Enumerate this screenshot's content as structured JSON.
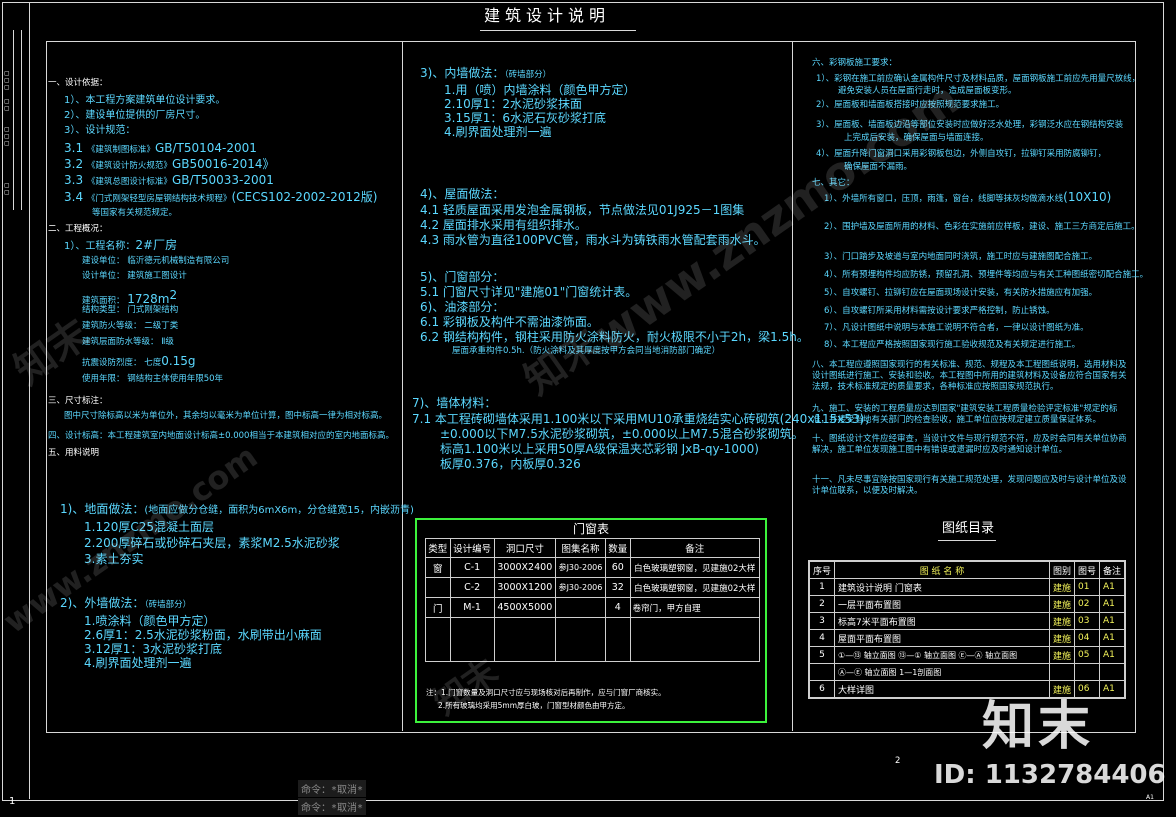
{
  "title": "建筑设计说明",
  "col1": {
    "s1_head": "一、设计依据：",
    "s1_items": [
      "1）、本工程方案建筑单位设计要求。",
      "2）、建设单位提供的厂房尺寸。",
      "3）、设计规范："
    ],
    "norms": [
      {
        "n": "3.1",
        "lbl": "《建筑制图标准》",
        "code": "GB/T50104-2001"
      },
      {
        "n": "3.2",
        "lbl": "《建筑设计防火规范》",
        "code": "GB50016-2014》"
      },
      {
        "n": "3.3",
        "lbl": "《建筑总图设计标准》",
        "code": "GB/T50033-2001"
      },
      {
        "n": "3.4",
        "lbl": "《门式刚架轻型房屋钢结构技术规程》",
        "code": "(CECS102-2002-2012版)"
      }
    ],
    "norms_tail": "等国家有关规范规定。",
    "s2_head": "二、工程概况：",
    "proj_lbl": "1）、工程名称：",
    "proj_val": "2#厂房",
    "info": [
      "建设单位：   临沂德元机械制造有限公司",
      "设计单位：   建筑施工图设计",
      "建筑面积：",
      "结构类型：   门式刚架结构",
      "建筑防火等级：  二级丁类",
      "建筑层面防水等级：  Ⅱ级",
      "抗震设防烈度：  七度"
    ],
    "area_val": "1728m",
    "area_sup": "2",
    "seis_val": "0.15g",
    "life": "使用年限：   钢结构主体使用年限50年",
    "s3_head": "三、尺寸标注：",
    "s3_body": "图中尺寸除标高以米为单位外，其余均以毫米为单位计算，图中标高一律为相对标高。",
    "s4": "四、设计标高：本工程建筑室内地面设计标高±0.000相当于本建筑相对应的室内地面标高。",
    "s5": "五、用料说明",
    "floor_head": "1)、地面做法：",
    "floor_note": "(地面应做分仓缝，面积为6mX6m，分仓缝宽15，内嵌沥青)",
    "floor_items": [
      "1.120厚C25混凝土面层",
      "2.200厚碎石或砂碎石夹层，素浆M2.5水泥砂浆",
      "3.素土夯实"
    ],
    "wall_head": "2)、外墙做法：",
    "wall_note": "（砖墙部分）",
    "wall_items": [
      "1.喷涂料（颜色甲方定）",
      "2.6厚1：2.5水泥砂浆粉面，水刷带出小麻面",
      "3.12厚1：3水泥砂浆打底",
      "4.刷界面处理剂一遍"
    ]
  },
  "col2": {
    "in_head": "3)、内墙做法：",
    "in_note": "（砖墙部分）",
    "in_items": [
      "1.用（喷）内墙涂料（颜色甲方定）",
      "2.10厚1：2水泥砂浆抹面",
      "3.15厚1：6水泥石灰砂浆打底",
      "4.刷界面处理剂一遍"
    ],
    "roof_head": "4)、屋面做法：",
    "roof_items": [
      "4.1  轻质屋面采用发泡金属钢板，节点做法见01J925－1图集",
      "4.2  屋面排水采用有组织排水。",
      "4.3  雨水管为直径100PVC管，雨水斗为铸铁雨水管配套雨水斗。"
    ],
    "door_head": "5)、门窗部分：",
    "door_items": [
      "5.1  门窗尺寸详见\"建施01\"门窗统计表。"
    ],
    "paint_head": "6)、油漆部分：",
    "paint_items": [
      "6.1  彩钢板及构件不需油漆饰面。",
      "6.2  钢结构构件，钢柱采用防火涂料防火，耐火极限不小于2h，梁1.5h。",
      "屋面承重构件0.5h.（防火涂料及其厚度按甲方会同当地消防部门确定）"
    ],
    "wall_head": "7)、墙体材料：",
    "wall_items": [
      "7.1  本工程砖砌墙体采用1.100米以下采用MU10承重烧结实心砖砌筑(240x115x53)，",
      "±0.000以下M7.5水泥砂浆砌筑，±0.000以上M7.5混合砂浆砌筑。",
      "标高1.100米以上采用50厚A级保温夹芯彩钢 JxB-qy-1000)",
      "板厚0.376，内板厚0.326"
    ]
  },
  "door_table": {
    "title": "门窗表",
    "headers": [
      "类型",
      "设计编号",
      "洞口尺寸",
      "图集名称",
      "数量",
      "备注"
    ],
    "rows": [
      [
        "窗",
        "C-1",
        "3000X2400",
        "参J30-2006",
        "60",
        "白色玻璃塑钢窗，见建施02大样"
      ],
      [
        "",
        "C-2",
        "3000X1200",
        "参J30-2006",
        "32",
        "白色玻璃塑钢窗，见建施02大样"
      ],
      [
        "门",
        "M-1",
        "4500X5000",
        "",
        "4",
        "卷帘门，甲方自理"
      ]
    ],
    "notes": [
      "注：1.门窗数量及洞口尺寸应与现场核对后再制作，应与门窗厂商核实。",
      "2.所有玻璃均采用5mm厚白玻，门窗型材颜色由甲方定。"
    ]
  },
  "col3": {
    "s6_head": "六、彩钢板施工要求：",
    "s6_items": [
      "1）、彩钢在施工前应确认金属构件尺寸及材料品质，屋面钢板施工前应先用量尺放线，",
      "避免安装人员在屋面行走时，造成屋面板变形。",
      "2）、屋面板和墙面板搭接时应按照规范要求施工。",
      "3）、屋面板、墙面板边沿等部位安装时应做好泛水处理，彩钢泛水应在钢结构安装",
      "上完成后安装，确保屋面与墙面连接。",
      "4）、屋面升降门窗洞口采用彩钢板包边，外侧自攻钉，拉铆钉采用防腐铆钉，",
      "确保屋面不漏雨。"
    ],
    "s7_head": "七、其它：",
    "s7_items": [
      "1）、外墙所有窗口，压顶，雨篷，窗台，线脚等抹灰均做滴水线",
      "2）、围护墙及屋面所用的材料、色彩在实施前应样板，建设、施工三方商定后施工。",
      "3）、门口踏步及坡道与室内地面同时浇筑，施工时应与建施图配合施工。",
      "4）、所有预埋构件均应防锈，预留孔洞、预埋件等均应与有关工种图纸密切配合施工。",
      "5）、自攻螺钉、拉铆钉应在屋面现场设计安装，有关防水措施应有加强。",
      "6）、自攻螺钉所采用材料需按设计要求严格控制，防止锈蚀。",
      "7）、凡设计图纸中说明与本施工说明不符合者，一律以设计图纸为准。",
      "8）、本工程应严格按照国家现行施工验收规范及有关规定进行施工。"
    ],
    "s7_pitch": "(10X10)",
    "s8": "八、本工程应遵照国家现行的有关标准、规范、规程及本工程图纸说明，选用材料及设计图纸进行施工、安装和验收。本工程图中所用的建筑材料及设备应符合国家有关法规，技术标准规定的质量要求，各种标准应按照国家规范执行。",
    "s9": "九、施工、安装的工程质量应达到国家\"建筑安装工程质量检验评定标准\"规定的标准，并接受当地有关部门的检查验收，施工单位应按规定建立质量保证体系。",
    "s10": "十、图纸设计文件应经审查，当设计文件与现行规范不符，应及时会同有关单位协商解决，施工单位发现施工图中有错误或遗漏时应及时通知设计单位。",
    "s11": "十一、凡未尽事宜除按国家现行有关施工规范处理，发现问题应及时与设计单位及设计单位联系，以便及时解决。"
  },
  "index_table": {
    "title": "图纸目录",
    "headers": [
      "序号",
      "图 纸 名 称",
      "图别",
      "图号",
      "备注"
    ],
    "rows": [
      [
        "1",
        "建筑设计说明     门窗表",
        "建施",
        "01",
        "A1"
      ],
      [
        "2",
        "一层平面布置图",
        "建施",
        "02",
        "A1"
      ],
      [
        "3",
        "标高7米平面布置图",
        "建施",
        "03",
        "A1"
      ],
      [
        "4",
        "屋面平面布置图",
        "建施",
        "04",
        "A1"
      ],
      [
        "5",
        "①—⑬ 轴立面图    ⑬—① 轴立面图    Ⓔ—Ⓐ 轴立面图",
        "建施",
        "05",
        "A1"
      ],
      [
        "",
        "Ⓐ—Ⓔ 轴立面图    1—1剖面图",
        "",
        "",
        ""
      ],
      [
        "6",
        "大样详图",
        "建施",
        "06",
        "A1"
      ]
    ]
  },
  "page_number": "2",
  "commands": [
    "命令：*取消*",
    "命令：*取消*"
  ],
  "brand": "知末",
  "id_text": "ID: 1132784406",
  "wm_text": "www.znzmo.com",
  "corner_1": "1",
  "corner_sheet": "A1"
}
